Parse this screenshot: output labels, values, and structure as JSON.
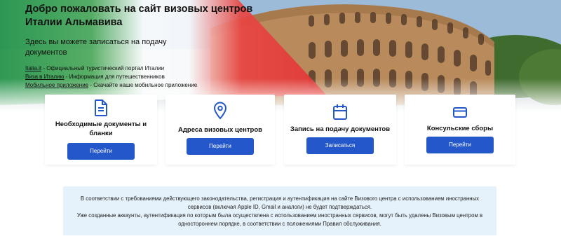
{
  "hero": {
    "title": "Добро пожаловать на сайт визовых центров Италии Альмавива",
    "subtitle": "Здесь вы можете записаться на подачу документов",
    "links": [
      {
        "link_text": "Italia.it",
        "description": " - Официальный туристический портал Италии"
      },
      {
        "link_text": "Виза в Италию",
        "description": " - Информация для путешественников"
      },
      {
        "link_text": "Мобильное приложение",
        "description": " - Скачайте наше мобильное приложение"
      }
    ]
  },
  "cards": [
    {
      "icon": "document-icon",
      "title": "Необходимые документы и бланки",
      "button": "Перейти"
    },
    {
      "icon": "location-pin-icon",
      "title": "Адреса визовых центров",
      "button": "Перейти"
    },
    {
      "icon": "calendar-icon",
      "title": "Запись на подачу документов",
      "button": "Записаться"
    },
    {
      "icon": "credit-card-icon",
      "title": "Консульские сборы",
      "button": "Перейти"
    }
  ],
  "notice": {
    "line1": "В соответствии с требованиями действующего законодательства, регистрация и аутентификация на сайте Визового центра с использованием иностранных сервисов (включая Apple ID, Gmail и аналоги) не будет подтверждаться.",
    "line2": "Уже созданные аккаунты, аутентификация по которым была осуществлена с использованием иностранных сервисов, могут быть удалены Визовым центром в одностороннем порядке, в соответствии с положениями Правил обслуживания."
  },
  "colors": {
    "button_blue": "#2457c9",
    "icon_blue": "#2457c9",
    "notice_bg": "#e6f2fb",
    "flag_green": "#229448",
    "flag_red": "#e23636"
  }
}
